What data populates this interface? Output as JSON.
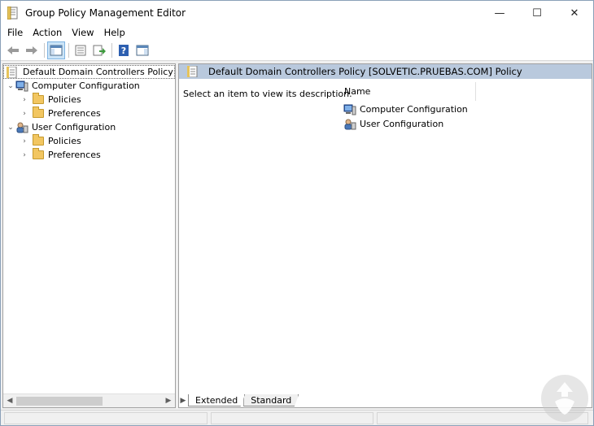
{
  "window": {
    "title": "Group Policy Management Editor",
    "controls": {
      "minimize": "—",
      "maximize": "☐",
      "close": "✕"
    }
  },
  "menu": [
    {
      "label": "File"
    },
    {
      "label": "Action"
    },
    {
      "label": "View"
    },
    {
      "label": "Help"
    }
  ],
  "toolbar": {
    "buttons": [
      {
        "name": "back-icon"
      },
      {
        "name": "forward-icon"
      },
      {
        "name": "show-hide-console-tree-icon"
      },
      {
        "name": "properties-icon"
      },
      {
        "name": "export-list-icon"
      },
      {
        "name": "help-icon"
      },
      {
        "name": "show-hide-action-pane-icon"
      }
    ]
  },
  "tree": {
    "root": {
      "label": "Default Domain Controllers Policy [SOLVETIC.PRUEBAS.COM] Policy"
    },
    "nodes": [
      {
        "label": "Computer Configuration",
        "icon": "computer-icon",
        "children": [
          {
            "label": "Policies"
          },
          {
            "label": "Preferences"
          }
        ]
      },
      {
        "label": "User Configuration",
        "icon": "users-icon",
        "children": [
          {
            "label": "Policies"
          },
          {
            "label": "Preferences"
          }
        ]
      }
    ]
  },
  "details": {
    "header": "Default Domain Controllers Policy [SOLVETIC.PRUEBAS.COM] Policy",
    "description": "Select an item to view its description.",
    "column_name": "Name",
    "items": [
      {
        "label": "Computer Configuration"
      },
      {
        "label": "User Configuration"
      }
    ]
  },
  "tabs": [
    {
      "label": "Extended",
      "active": true
    },
    {
      "label": "Standard",
      "active": false
    }
  ],
  "colors": {
    "header_bg": "#b9c9dd",
    "selection_border": "#7fb4e2",
    "folder": "#f2c661"
  }
}
